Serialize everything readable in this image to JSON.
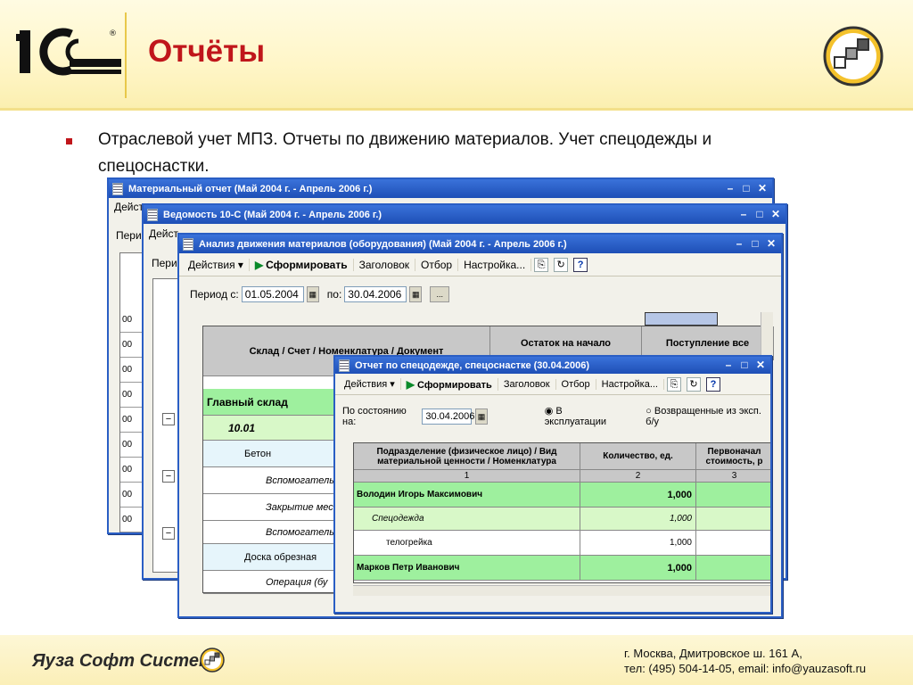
{
  "slide": {
    "title": "Отчёты",
    "bullet": "Отраслевой учет МПЗ. Отчеты по движению материалов. Учет спецодежды и спецоснастки."
  },
  "win1": {
    "title": "Материальный отчет (Май 2004 г. - Апрель 2006 г.)",
    "menu_fragment": "Дейст",
    "period_fragment": "Перио",
    "rows": [
      "00",
      "00",
      "00",
      "00",
      "00",
      "00",
      "00",
      "00",
      "00",
      "00"
    ]
  },
  "win2": {
    "title": "Ведомость 10-С  (Май 2004 г. - Апрель 2006 г.)",
    "menu_fragment": "Дейст",
    "period_fragment": "Перио"
  },
  "win3": {
    "title": "Анализ движения материалов (оборудования) (Май 2004 г. - Апрель 2006 г.)",
    "toolbar": {
      "actions": "Действия",
      "generate": "Сформировать",
      "header": "Заголовок",
      "filter": "Отбор",
      "settings": "Настройка..."
    },
    "period_label": "Период с:",
    "period_from": "01.05.2004",
    "period_to_label": "по:",
    "period_to": "30.04.2006",
    "ellipsis": "...",
    "table": {
      "col1": "Склад / Счет / Номенклатура / Документ",
      "col2": "Остаток на начало",
      "col3": "Поступление все",
      "rows": [
        {
          "label": "Главный склад"
        },
        {
          "label": "10.01"
        },
        {
          "label": "Бетон"
        },
        {
          "label": "Вспомогатель"
        },
        {
          "label": "Закрытие мес"
        },
        {
          "label": "Вспомогатель"
        },
        {
          "label": "Доска обрезная"
        },
        {
          "label": "Операция (бу"
        }
      ]
    }
  },
  "win4": {
    "title": "Отчет по спецодежде, спецоснастке (30.04.2006)",
    "toolbar": {
      "actions": "Действия",
      "generate": "Сформировать",
      "header": "Заголовок",
      "filter": "Отбор",
      "settings": "Настройка..."
    },
    "state_label": "По состоянию на:",
    "state_date": "30.04.2006",
    "radio1": "В эксплуатации",
    "radio2": "Возвращенные из эксп. б/у",
    "table": {
      "col1": "Подразделение (физическое лицо) / Вид материальной ценности / Номенклатура",
      "col2": "Количество, ед.",
      "col3": "Первоначал стоимость, р",
      "num1": "1",
      "num2": "2",
      "num3": "3",
      "rows": [
        {
          "label": "Володин Игорь Максимович",
          "qty": "1,000"
        },
        {
          "label": "Спецодежда",
          "qty": "1,000"
        },
        {
          "label": "телогрейка",
          "qty": "1,000"
        },
        {
          "label": "Марков Петр Иванович",
          "qty": "1,000"
        }
      ]
    }
  },
  "footer": {
    "brand": "Яуза Софт Системз",
    "address": "г. Москва, Дмитровское ш. 161 А,",
    "contacts": "тел: (495) 504-14-05, email: info@yauzasoft.ru"
  },
  "colors": {
    "title_red": "#c0161b",
    "titlebar_blue": "#1e4fb6",
    "row_green": "#9ef09e"
  }
}
